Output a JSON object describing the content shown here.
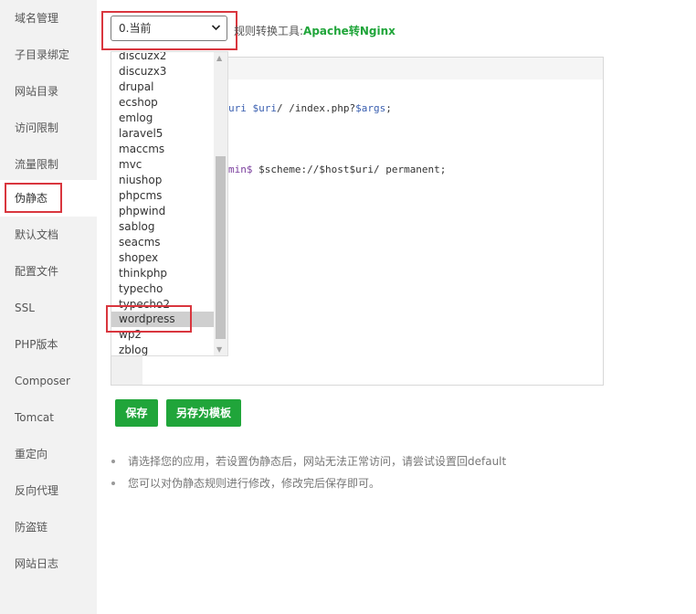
{
  "sidebar": {
    "items": [
      {
        "label": "域名管理"
      },
      {
        "label": "子目录绑定"
      },
      {
        "label": "网站目录"
      },
      {
        "label": "访问限制"
      },
      {
        "label": "流量限制"
      },
      {
        "label": "伪静态"
      },
      {
        "label": "默认文档"
      },
      {
        "label": "配置文件"
      },
      {
        "label": "SSL"
      },
      {
        "label": "PHP版本"
      },
      {
        "label": "Composer"
      },
      {
        "label": "Tomcat"
      },
      {
        "label": "重定向"
      },
      {
        "label": "反向代理"
      },
      {
        "label": "防盗链"
      },
      {
        "label": "网站日志"
      }
    ],
    "active_label": "伪静态"
  },
  "rewrite": {
    "select_value": "0.当前",
    "tool_label": "规则转换工具:",
    "tool_link": "Apache转Nginx",
    "options": [
      "discuzx2",
      "discuzx3",
      "drupal",
      "ecshop",
      "emlog",
      "laravel5",
      "maccms",
      "mvc",
      "niushop",
      "phpcms",
      "phpwind",
      "sablog",
      "seacms",
      "shopex",
      "thinkphp",
      "typecho",
      "typecho2",
      "wordpress",
      "wp2",
      "zblog"
    ],
    "selected_option": "wordpress"
  },
  "editor": {
    "line1": {
      "a": "uri ",
      "b": "$uri",
      "c": "/ /index.php?",
      "d": "$args",
      "e": ";"
    },
    "line2": {
      "a": "min$ ",
      "b": "$scheme://$host$uri/ permanent;"
    }
  },
  "buttons": {
    "save": "保存",
    "save_template": "另存为模板"
  },
  "notes": [
    "请选择您的应用，若设置伪静态后，网站无法正常访问，请尝试设置回default",
    "您可以对伪静态规则进行修改，修改完后保存即可。"
  ],
  "colors": {
    "accent": "#20a53a",
    "highlight": "#d9363e"
  }
}
